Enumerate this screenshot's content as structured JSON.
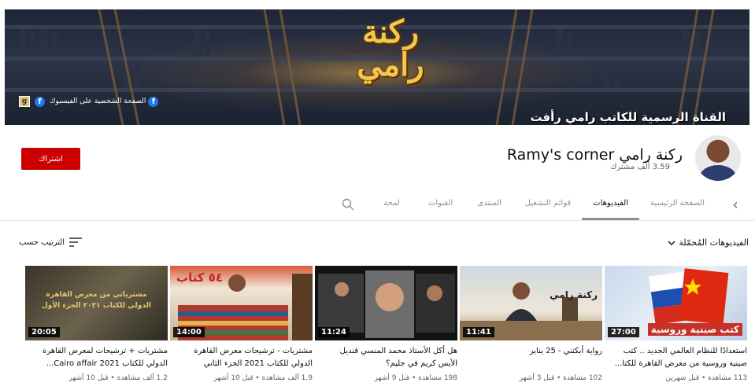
{
  "banner": {
    "logo_text": "ركنة\nرامي",
    "subtitle": "القناة الرسمية للكاتب رامي رأفت",
    "fb_page_label": "الصفحة الشخصية على الفيسبوك",
    "g_label": "g"
  },
  "channel": {
    "name": "ركنة رامي Ramy's corner",
    "subscribers": "3.59 ألف مشترك",
    "subscribe_label": "اشتراك"
  },
  "tabs": [
    {
      "label": "الصفحة الرئيسية",
      "active": false
    },
    {
      "label": "الفيديوهات",
      "active": true
    },
    {
      "label": "قوائم التشغيل",
      "active": false
    },
    {
      "label": "المنتدى",
      "active": false
    },
    {
      "label": "القنوات",
      "active": false
    },
    {
      "label": "لمحة",
      "active": false
    }
  ],
  "section": {
    "title": "الفيديوهات المُحمّلة",
    "sort_label": "الترتيب حسب"
  },
  "videos": [
    {
      "duration": "27:00",
      "title": "استعدادًا للنظام العالمي الجديد .. كتب صينية وروسية من معرض القاهرة للكتا...",
      "meta": "113 مشاهدة • قبل شهرين",
      "thumb_text": "كتب صينية وروسية"
    },
    {
      "duration": "11:41",
      "title": "رواية أبكتني - 25 يناير",
      "meta": "102 مشاهدة • قبل 3 أشهر",
      "thumb_text": "ركنة رامي"
    },
    {
      "duration": "11:24",
      "title": "هل أكل الأستاذ محمد المنسي قنديل الأيس كريم في جليم؟",
      "meta": "198 مشاهدة • قبل 9 أشهر",
      "thumb_text": ""
    },
    {
      "duration": "14:00",
      "title": "مشتريات - ترشيحات معرض القاهرة الدولي للكتاب 2021 الجزء الثاني",
      "meta": "1.9 ألف مشاهدة • قبل 10 أشهر",
      "thumb_text": "٥٤ كتاب"
    },
    {
      "duration": "20:05",
      "title": "مشتريات + ترشيحات لمعرض القاهرة الدولي للكتاب Cairo affair 2021...",
      "meta": "1.2 ألف مشاهدة • قبل 10 أشهر",
      "thumb_text": "مشترياتي من معرض القاهرة الدولي للكتاب ٢٠٢١ الجزء الأول"
    }
  ]
}
